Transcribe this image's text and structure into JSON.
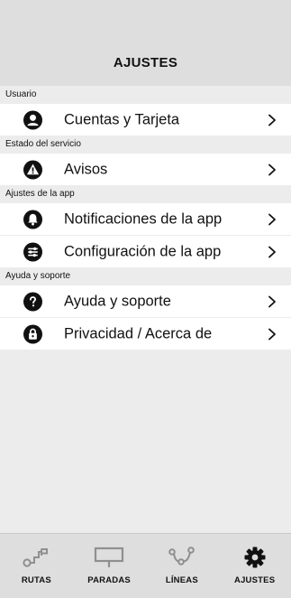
{
  "header": {
    "title": "AJUSTES"
  },
  "sections": [
    {
      "title": "Usuario",
      "items": [
        {
          "label": "Cuentas y Tarjeta",
          "icon": "user-icon"
        }
      ]
    },
    {
      "title": "Estado del servicio",
      "items": [
        {
          "label": "Avisos",
          "icon": "warning-icon"
        }
      ]
    },
    {
      "title": "Ajustes de la app",
      "items": [
        {
          "label": "Notificaciones de la app",
          "icon": "bell-icon"
        },
        {
          "label": "Configuración de la app",
          "icon": "sliders-icon"
        }
      ]
    },
    {
      "title": "Ayuda y soporte",
      "items": [
        {
          "label": "Ayuda y soporte",
          "icon": "help-icon"
        },
        {
          "label": "Privacidad / Acerca de",
          "icon": "lock-icon"
        }
      ]
    }
  ],
  "tabbar": {
    "tabs": [
      {
        "label": "RUTAS",
        "icon": "route-icon",
        "active": false
      },
      {
        "label": "PARADAS",
        "icon": "stop-sign-icon",
        "active": false
      },
      {
        "label": "LÍNEAS",
        "icon": "lines-icon",
        "active": false
      },
      {
        "label": "AJUSTES",
        "icon": "gear-icon",
        "active": true
      }
    ]
  },
  "colors": {
    "background": "#ececec",
    "header": "#dedede",
    "row": "#ffffff",
    "text": "#111111",
    "inactive_icon": "#8f8f8f",
    "active_icon": "#111111"
  }
}
